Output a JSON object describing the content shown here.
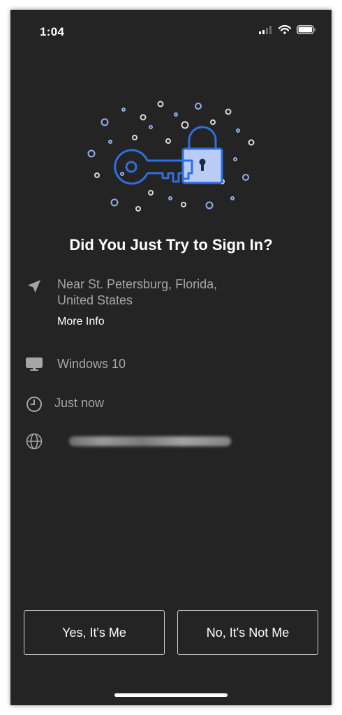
{
  "status_bar": {
    "time": "1:04",
    "icons": [
      "cellular-signal-icon",
      "wifi-icon",
      "battery-icon"
    ]
  },
  "hero_icon": "key-and-padlock-illustration",
  "title": "Did You Just Try to Sign In?",
  "details": {
    "location": {
      "icon": "location-arrow-icon",
      "text": "Near St. Petersburg, Florida, United States"
    },
    "more_info": "More Info",
    "device": {
      "icon": "monitor-icon",
      "text": "Windows 10"
    },
    "time": {
      "icon": "clock-icon",
      "text": "Just now"
    },
    "ip": {
      "icon": "globe-icon",
      "text": ""
    }
  },
  "buttons": {
    "yes": "Yes, It's Me",
    "no": "No, It's Not Me"
  },
  "colors": {
    "background": "#242424",
    "accent_blue": "#2f6fe0",
    "lock_fill": "#b8ccf5",
    "text_primary": "#ffffff",
    "text_secondary": "#a6a6a6"
  }
}
